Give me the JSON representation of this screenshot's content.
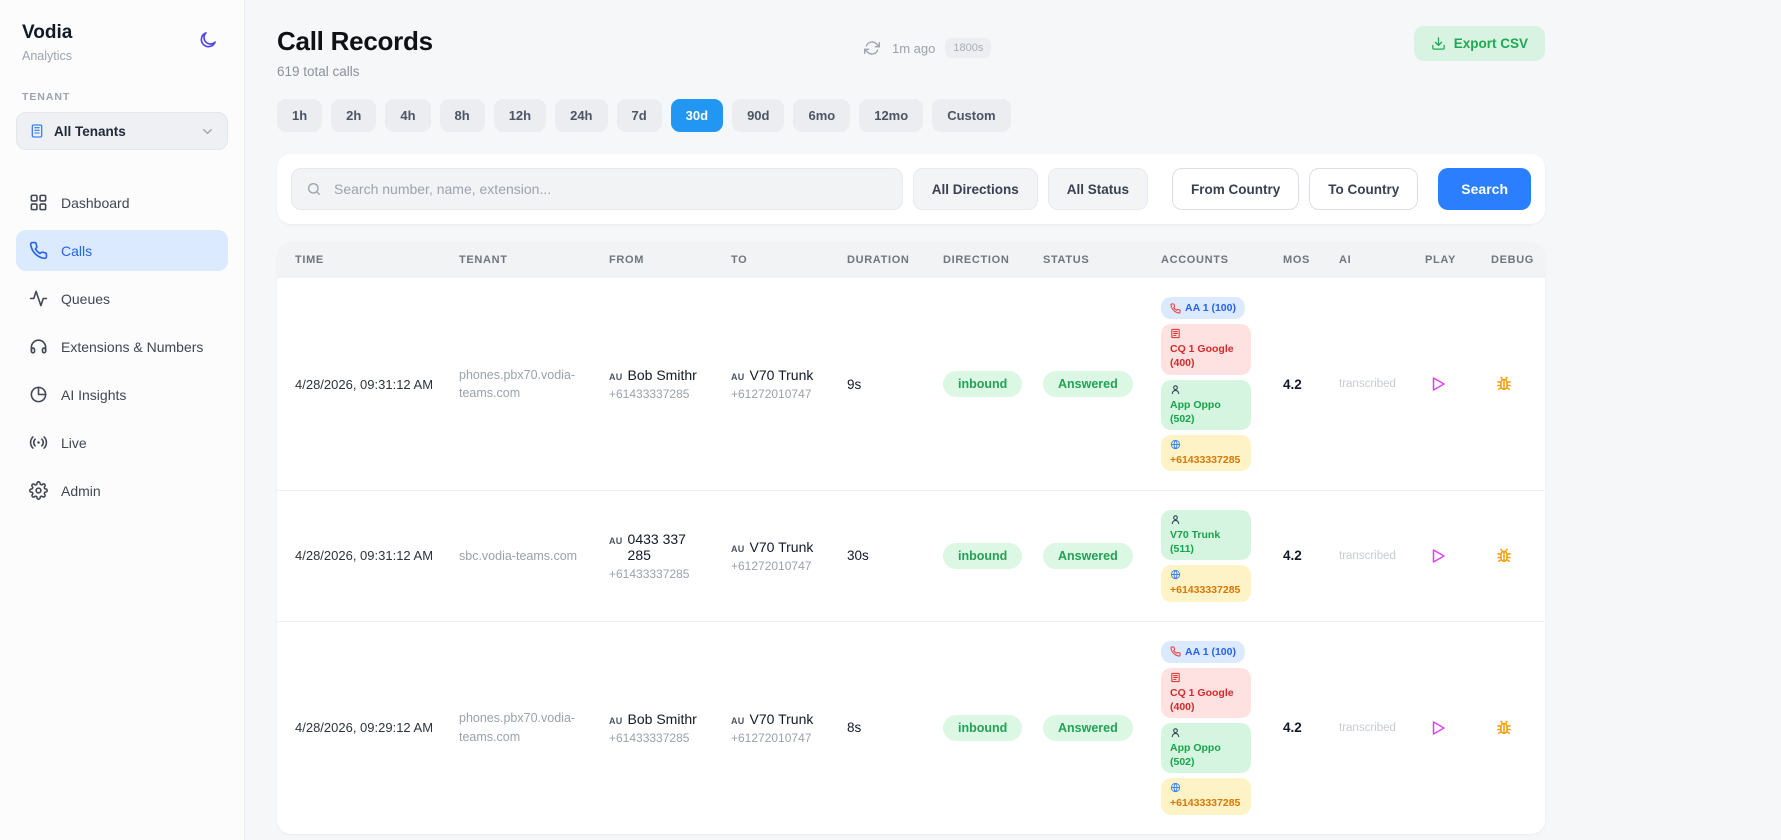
{
  "colors": {
    "accent_blue": "#2196f3",
    "primary_button_blue": "#2b7fff",
    "success_green": "#22a256",
    "export_green_bg": "#d9f3e3",
    "active_nav_bg": "#dbeafe",
    "play_magenta": "#d946ef",
    "debug_orange": "#f59e0b"
  },
  "sidebar": {
    "brand": {
      "title": "Vodia",
      "subtitle": "Analytics"
    },
    "tenant_label": "TENANT",
    "tenant_selected": "All Tenants",
    "nav": [
      {
        "label": "Dashboard",
        "active": false
      },
      {
        "label": "Calls",
        "active": true
      },
      {
        "label": "Queues",
        "active": false
      },
      {
        "label": "Extensions & Numbers",
        "active": false
      },
      {
        "label": "AI Insights",
        "active": false
      },
      {
        "label": "Live",
        "active": false
      },
      {
        "label": "Admin",
        "active": false
      }
    ]
  },
  "header": {
    "title": "Call Records",
    "subtitle": "619 total calls",
    "refresh_ago": "1m ago",
    "refresh_interval": "1800s",
    "export_label": "Export CSV"
  },
  "time_filters": {
    "options": [
      "1h",
      "2h",
      "4h",
      "8h",
      "12h",
      "24h",
      "7d",
      "30d",
      "90d",
      "6mo",
      "12mo",
      "Custom"
    ],
    "active": "30d"
  },
  "search": {
    "placeholder": "Search number, name, extension...",
    "filters": [
      "All Directions",
      "All Status",
      "From Country",
      "To Country"
    ],
    "button": "Search"
  },
  "table": {
    "columns": [
      "TIME",
      "TENANT",
      "FROM",
      "TO",
      "DURATION",
      "DIRECTION",
      "STATUS",
      "ACCOUNTS",
      "MOS",
      "AI",
      "PLAY",
      "DEBUG"
    ],
    "rows": [
      {
        "time": "4/28/2026, 09:31:12 AM",
        "tenant": "phones.pbx70.vodia-teams.com",
        "from_country": "AU",
        "from_name": "Bob Smithr",
        "from_number": "+61433337285",
        "to_country": "AU",
        "to_name": "V70 Trunk",
        "to_number": "+61272010747",
        "duration": "9s",
        "direction": "inbound",
        "status": "Answered",
        "accounts": [
          {
            "label": "AA 1 (100)",
            "icon": "phone",
            "color": "blue"
          },
          {
            "label": "CQ 1 Google (400)",
            "icon": "queue",
            "color": "red"
          },
          {
            "label": "App Oppo (502)",
            "icon": "person",
            "color": "green"
          },
          {
            "label": "+61433337285",
            "icon": "globe",
            "color": "orange"
          }
        ],
        "mos": "4.2",
        "ai": "transcribed"
      },
      {
        "time": "4/28/2026, 09:31:12 AM",
        "tenant": "sbc.vodia-teams.com",
        "from_country": "AU",
        "from_name": "0433 337 285",
        "from_number": "+61433337285",
        "to_country": "AU",
        "to_name": "V70 Trunk",
        "to_number": "+61272010747",
        "duration": "30s",
        "direction": "inbound",
        "status": "Answered",
        "accounts": [
          {
            "label": "V70 Trunk (511)",
            "icon": "person",
            "color": "green"
          },
          {
            "label": "+61433337285",
            "icon": "globe",
            "color": "orange"
          }
        ],
        "mos": "4.2",
        "ai": "transcribed"
      },
      {
        "time": "4/28/2026, 09:29:12 AM",
        "tenant": "phones.pbx70.vodia-teams.com",
        "from_country": "AU",
        "from_name": "Bob Smithr",
        "from_number": "+61433337285",
        "to_country": "AU",
        "to_name": "V70 Trunk",
        "to_number": "+61272010747",
        "duration": "8s",
        "direction": "inbound",
        "status": "Answered",
        "accounts": [
          {
            "label": "AA 1 (100)",
            "icon": "phone",
            "color": "blue"
          },
          {
            "label": "CQ 1 Google (400)",
            "icon": "queue",
            "color": "red"
          },
          {
            "label": "App Oppo (502)",
            "icon": "person",
            "color": "green"
          },
          {
            "label": "+61433337285",
            "icon": "globe",
            "color": "orange"
          }
        ],
        "mos": "4.2",
        "ai": "transcribed"
      }
    ]
  }
}
